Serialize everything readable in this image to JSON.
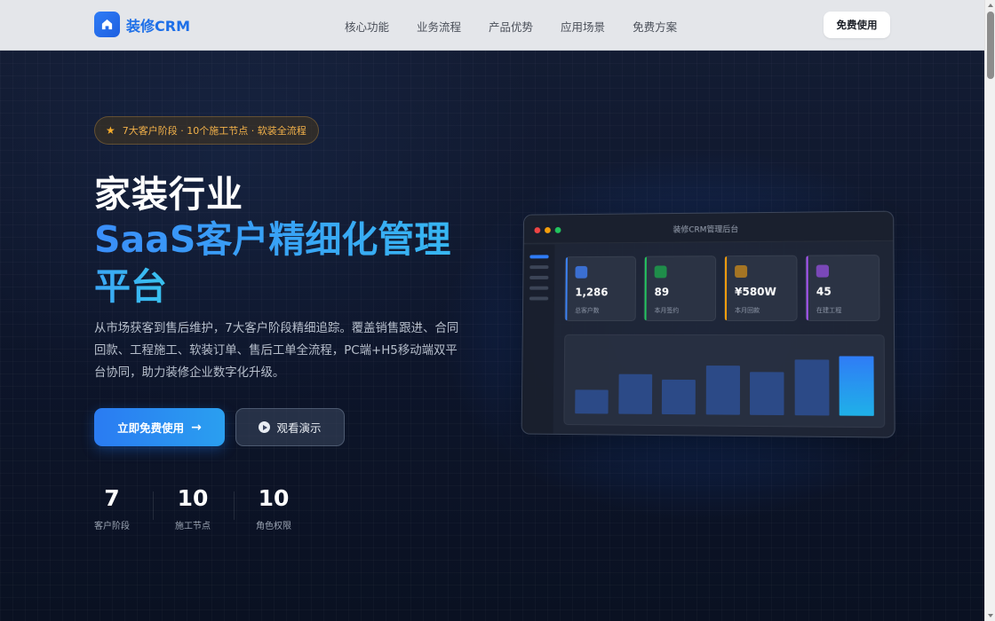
{
  "nav": {
    "brand": "装修CRM",
    "links": [
      "核心功能",
      "业务流程",
      "产品优势",
      "应用场景",
      "免费方案"
    ],
    "cta": "免费使用"
  },
  "hero": {
    "badge": {
      "icon": "star-icon",
      "text": "7大客户阶段 · 10个施工节点 · 软装全流程"
    },
    "title_line1": "家装行业",
    "title_line2": "SaaS客户精细化管理",
    "title_line3": "平台",
    "description": "从市场获客到售后维护，7大客户阶段精细追踪。覆盖销售跟进、合同回款、工程施工、软装订单、售后工单全流程，PC端+H5移动端双平台协同，助力装修企业数字化升级。",
    "primary_button": "立即免费使用",
    "secondary_button": "观看演示",
    "stats": [
      {
        "value": "7",
        "label": "客户阶段"
      },
      {
        "value": "10",
        "label": "施工节点"
      },
      {
        "value": "10",
        "label": "角色权限"
      }
    ]
  },
  "dashboard": {
    "window_title": "装修CRM管理后台",
    "cards": [
      {
        "value": "1,286",
        "label": "总客户数",
        "color": "#3b82f6"
      },
      {
        "value": "89",
        "label": "本月签约",
        "color": "#22c55e"
      },
      {
        "value": "¥580W",
        "label": "本月回款",
        "color": "#f59e0b"
      },
      {
        "value": "45",
        "label": "在建工程",
        "color": "#a855f7"
      }
    ],
    "chart_bars": [
      0.35,
      0.58,
      0.5,
      0.7,
      0.62,
      0.8,
      0.85
    ]
  },
  "colors": {
    "accent": "#2f7cf6",
    "badge_text": "#f4b24a",
    "background": "#0d152a"
  }
}
